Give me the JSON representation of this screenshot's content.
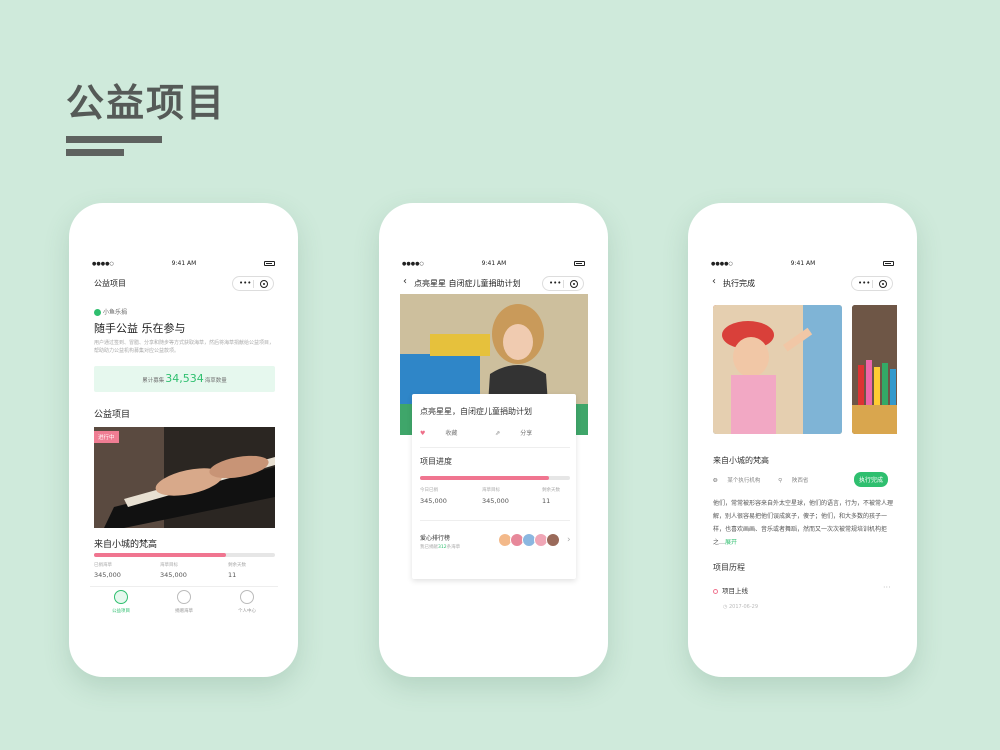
{
  "page": {
    "title": "公益项目"
  },
  "status": {
    "time": "9:41 AM",
    "dots": "●●●●○"
  },
  "capsule": {
    "more": "•••"
  },
  "phone1": {
    "nav_title": "公益项目",
    "brand": "小鱼乐捐",
    "slogan": "随手公益 乐在参与",
    "description": "用户通过签到、冒腊、分享和随步等方式获取海草，然后将海草捐献给公益项目，帮助助力公益机构募集对应公益款项。",
    "counter_prefix": "累计募集",
    "counter_value": "34,534",
    "counter_suffix": "海草数量",
    "section_title": "公益项目",
    "tag": "进行中",
    "project_name": "来自小城的梵高",
    "progress": 0.73,
    "stats": [
      {
        "label": "已捐海草",
        "value": "345,000"
      },
      {
        "label": "海草目标",
        "value": "345,000"
      },
      {
        "label": "剩余天数",
        "value": "11"
      }
    ],
    "tabs": [
      {
        "label": "公益项目",
        "icon": "charity-icon"
      },
      {
        "label": "捐赠海草",
        "icon": "seaweed-icon"
      },
      {
        "label": "个人中心",
        "icon": "user-icon"
      }
    ]
  },
  "phone2": {
    "nav_back": "‹",
    "nav_title": "点亮星星 自闭症儿童捐助计划",
    "card_title": "点亮星星，自闭症儿童捐助计划",
    "collect": "收藏",
    "share": "分享",
    "section_title": "项目进度",
    "progress": 0.86,
    "stats": [
      {
        "label": "今日已捐",
        "value": "345,000"
      },
      {
        "label": "海草目标",
        "value": "345,000"
      },
      {
        "label": "剩余天数",
        "value": "11"
      }
    ],
    "rank_title": "爱心排行榜",
    "rank_prefix": "我已捐献",
    "rank_value": "312",
    "rank_suffix": "条海草"
  },
  "phone3": {
    "nav_back": "‹",
    "nav_title": "执行完成",
    "project_name": "来自小城的梵高",
    "org": "某个执行机构",
    "location": "陕西省",
    "badge": "执行完成",
    "description": "他们，常常被形容来自外太空星球，他们的语言，行为，不被常人理解，别人很容易把他们误成疯子，傻子；他们，和大多数的孩子一样，也喜欢画画、音乐或者舞蹈，然而又一次次被常规培训机构拒之…",
    "more": "展开",
    "section_title": "项目历程",
    "event": "项目上线",
    "event_more": "···",
    "event_date": "2017-06-29"
  },
  "colors": {
    "accent": "#2fbf6f",
    "progress": "#f07590",
    "background": "#cfeadb"
  }
}
